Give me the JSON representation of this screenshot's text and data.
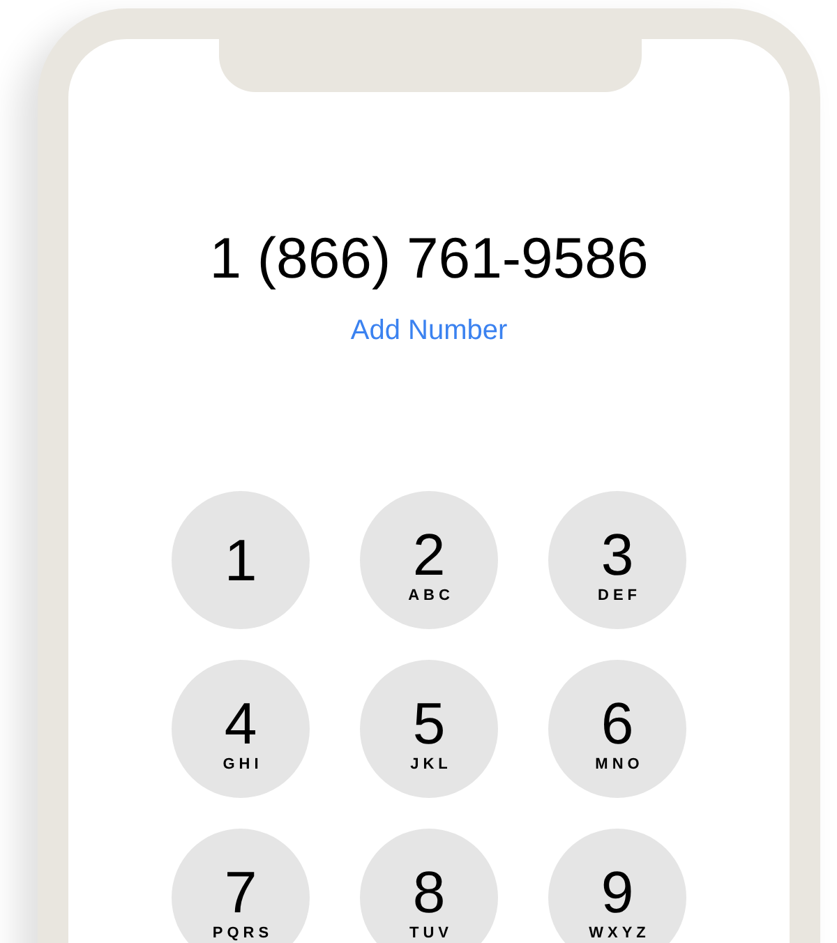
{
  "dialer": {
    "number": "1 (866) 761-9586",
    "add_link": "Add Number"
  },
  "keypad": [
    {
      "digit": "1"
    },
    {
      "digit": "2",
      "letters": "ABC"
    },
    {
      "digit": "3",
      "letters": "DEF"
    },
    {
      "digit": "4",
      "letters": "GHI"
    },
    {
      "digit": "5",
      "letters": "JKL"
    },
    {
      "digit": "6",
      "letters": "MNO"
    },
    {
      "digit": "7",
      "letters": "PQRS"
    },
    {
      "digit": "8",
      "letters": "TUV"
    },
    {
      "digit": "9",
      "letters": "WXYZ"
    }
  ]
}
